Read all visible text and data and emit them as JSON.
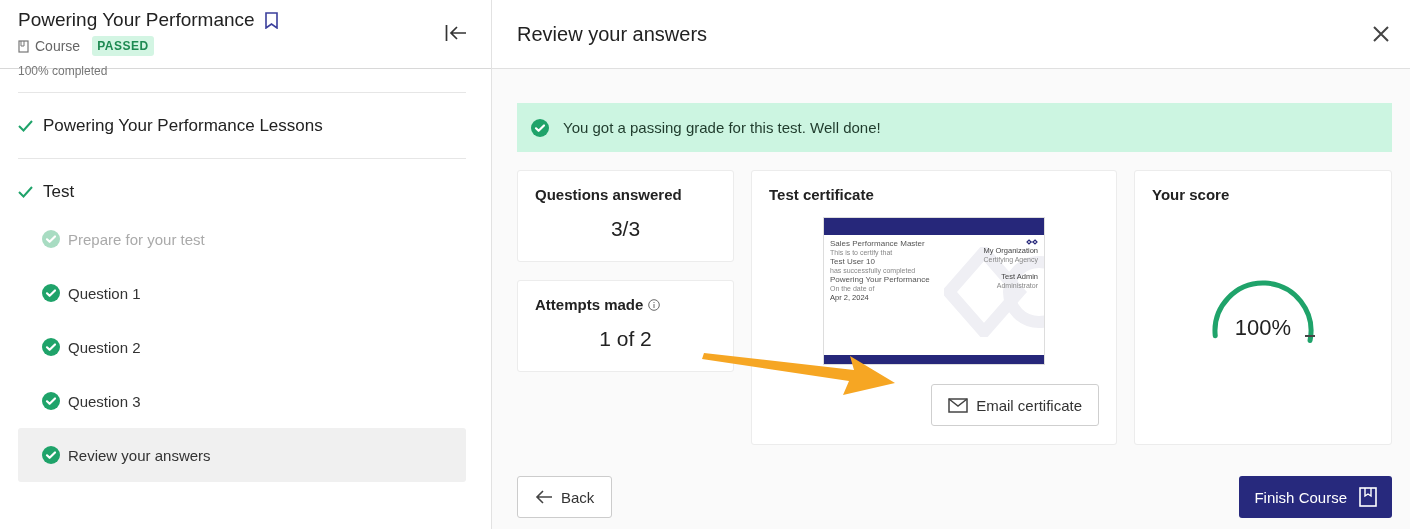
{
  "sidebar": {
    "title": "Powering Your Performance",
    "bookmarked": true,
    "type_label": "Course",
    "status_badge": "PASSED",
    "progress_text": "100% completed",
    "sections": [
      {
        "title": "Powering Your Performance Lessons",
        "completed": true
      },
      {
        "title": "Test",
        "completed": true,
        "children": [
          {
            "label": "Prepare for your test",
            "completed": true,
            "disabled": true,
            "selected": false
          },
          {
            "label": "Question 1",
            "completed": true,
            "disabled": false,
            "selected": false
          },
          {
            "label": "Question 2",
            "completed": true,
            "disabled": false,
            "selected": false
          },
          {
            "label": "Question 3",
            "completed": true,
            "disabled": false,
            "selected": false
          },
          {
            "label": "Review your answers",
            "completed": true,
            "disabled": false,
            "selected": true
          }
        ]
      }
    ]
  },
  "main": {
    "title": "Review your answers",
    "banner": "You got a passing grade for this test. Well done!",
    "stats": [
      {
        "label": "Questions answered",
        "value": "3/3",
        "info": false
      },
      {
        "label": "Attempts made",
        "value": "1 of 2",
        "info": true
      }
    ],
    "certificate": {
      "heading": "Test certificate",
      "name": "Sales Performance Master",
      "certify_text": "This is to certify that",
      "recipient": "Test User 10",
      "completed_text": "has successfully completed",
      "course": "Powering Your Performance",
      "date_text": "On the date of",
      "date": "Apr 2, 2024",
      "organization": "My Organization",
      "organization_role": "Certifying Agency",
      "signer": "Test Admin",
      "signer_role": "Administrator",
      "email_button": "Email certificate"
    },
    "score": {
      "heading": "Your score",
      "value": "100%"
    },
    "buttons": {
      "back": "Back",
      "finish": "Finish Course"
    }
  }
}
